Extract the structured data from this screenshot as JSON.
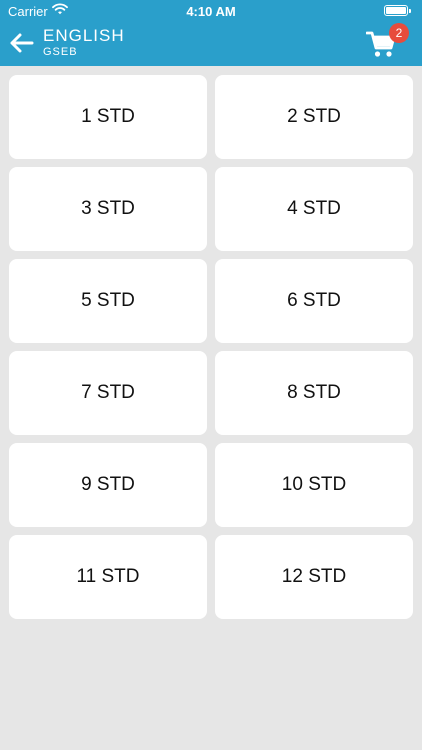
{
  "status_bar": {
    "carrier": "Carrier",
    "time": "4:10 AM"
  },
  "header": {
    "title": "ENGLISH",
    "subtitle": "GSEB",
    "back_icon": "arrow-left-icon",
    "cart_icon": "shopping-cart-icon",
    "cart_count": "2",
    "background_color": "#2a9fcb",
    "badge_color": "#e74c3c"
  },
  "standards": [
    "1 STD",
    "2 STD",
    "3 STD",
    "4 STD",
    "5 STD",
    "6 STD",
    "7 STD",
    "8 STD",
    "9 STD",
    "10 STD",
    "11 STD",
    "12 STD"
  ]
}
